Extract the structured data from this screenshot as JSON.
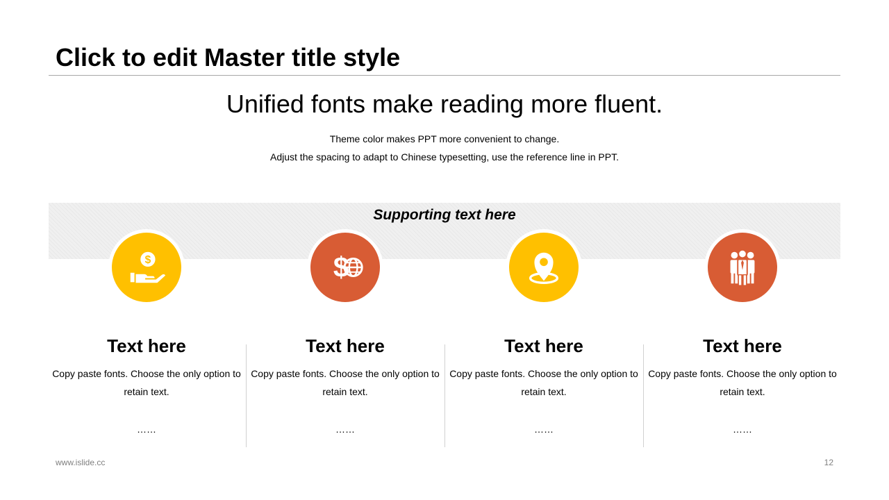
{
  "slide": {
    "master_title": "Click to edit Master title style",
    "headline": "Unified fonts make reading more fluent.",
    "sublines": [
      "Theme color makes PPT more convenient  to change.",
      "Adjust  the spacing to adapt to Chinese  typesetting,  use the  reference line in PPT."
    ],
    "supporting_text": "Supporting text here"
  },
  "colors": {
    "yellow": "#ffc000",
    "orange": "#d85c34"
  },
  "columns": [
    {
      "icon": "money-hand-icon",
      "title": "Text here",
      "body": "Copy paste fonts. Choose the only option to retain text.",
      "dots": "……"
    },
    {
      "icon": "dollar-globe-icon",
      "title": "Text here",
      "body": "Copy paste fonts. Choose the only option to retain text.",
      "dots": "……"
    },
    {
      "icon": "location-pin-icon",
      "title": "Text here",
      "body": "Copy paste fonts. Choose the only option to retain text.",
      "dots": "……"
    },
    {
      "icon": "team-icon",
      "title": "Text here",
      "body": "Copy paste fonts. Choose the only option to retain text.",
      "dots": "……"
    }
  ],
  "footer": {
    "website": "www.islide.cc",
    "page_number": "12"
  }
}
